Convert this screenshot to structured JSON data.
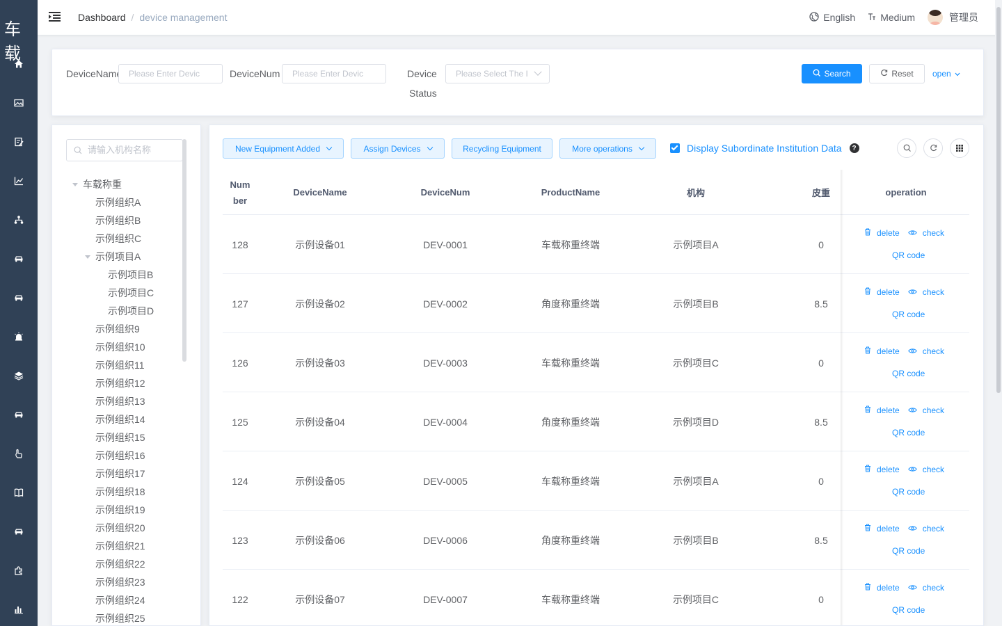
{
  "sidebar": {
    "logo": "车载",
    "icons": [
      "home-icon",
      "image-icon",
      "edit-icon",
      "chart-icon",
      "tree-icon",
      "car-icon",
      "car-icon",
      "alarm-icon",
      "layers-icon",
      "car-icon",
      "hand-icon",
      "book-icon",
      "car-icon",
      "plugin-icon",
      "bar-chart-icon"
    ]
  },
  "header": {
    "breadcrumb_home": "Dashboard",
    "breadcrumb_sep": "/",
    "breadcrumb_current": "device management",
    "language": "English",
    "size": "Medium",
    "user": "管理员"
  },
  "search": {
    "device_name_label": "DeviceName",
    "device_name_placeholder": "Please Enter Devic",
    "device_num_label": "DeviceNum",
    "device_num_placeholder": "Please Enter Devic",
    "status_label_1": "Device",
    "status_label_2": "Status",
    "status_placeholder": "Please Select The I",
    "search_btn": "Search",
    "reset_btn": "Reset",
    "toggle": "open"
  },
  "tree": {
    "search_placeholder": "请输入机构名称",
    "nodes": [
      {
        "label": "车载称重",
        "caret": true
      },
      {
        "label": "示例组织A"
      },
      {
        "label": "示例组织B"
      },
      {
        "label": "示例组织C"
      },
      {
        "label": "示例项目A",
        "caret": true
      },
      {
        "label": "示例项目B"
      },
      {
        "label": "示例项目C"
      },
      {
        "label": "示例项目D"
      },
      {
        "label": "示例组织9"
      },
      {
        "label": "示例组织10"
      },
      {
        "label": "示例组织11"
      },
      {
        "label": "示例组织12"
      },
      {
        "label": "示例组织13"
      },
      {
        "label": "示例组织14"
      },
      {
        "label": "示例组织15"
      },
      {
        "label": "示例组织16"
      },
      {
        "label": "示例组织17"
      },
      {
        "label": "示例组织18"
      },
      {
        "label": "示例组织19"
      },
      {
        "label": "示例组织20"
      },
      {
        "label": "示例组织21"
      },
      {
        "label": "示例组织22"
      },
      {
        "label": "示例组织23"
      },
      {
        "label": "示例组织24"
      },
      {
        "label": "示例组织25"
      }
    ]
  },
  "toolbar": {
    "new_equipment": "New Equipment Added",
    "assign_devices": "Assign Devices",
    "recycling": "Recycling Equipment",
    "more_ops": "More operations",
    "subordinate_label": "Display Subordinate Institution Data",
    "help": "?"
  },
  "table": {
    "headers": {
      "number_1": "Num",
      "number_2": "ber",
      "device_name": "DeviceName",
      "device_num": "DeviceNum",
      "product_name": "ProductName",
      "org": "机构",
      "tare": "皮重",
      "operation": "operation"
    },
    "actions": {
      "delete": "delete",
      "check": "check",
      "qr": "QR code"
    },
    "rows": [
      {
        "number": "128",
        "device_name": "示例设备01",
        "device_num": "DEV-0001",
        "product_name": "车载称重终端",
        "org": "示例项目A",
        "tare": "0"
      },
      {
        "number": "127",
        "device_name": "示例设备02",
        "device_num": "DEV-0002",
        "product_name": "角度称重终端",
        "org": "示例项目B",
        "tare": "8.5"
      },
      {
        "number": "126",
        "device_name": "示例设备03",
        "device_num": "DEV-0003",
        "product_name": "车载称重终端",
        "org": "示例项目C",
        "tare": "0"
      },
      {
        "number": "125",
        "device_name": "示例设备04",
        "device_num": "DEV-0004",
        "product_name": "角度称重终端",
        "org": "示例项目D",
        "tare": "8.5"
      },
      {
        "number": "124",
        "device_name": "示例设备05",
        "device_num": "DEV-0005",
        "product_name": "车载称重终端",
        "org": "示例项目A",
        "tare": "0"
      },
      {
        "number": "123",
        "device_name": "示例设备06",
        "device_num": "DEV-0006",
        "product_name": "角度称重终端",
        "org": "示例项目B",
        "tare": "8.5"
      },
      {
        "number": "122",
        "device_name": "示例设备07",
        "device_num": "DEV-0007",
        "product_name": "车载称重终端",
        "org": "示例项目C",
        "tare": "0"
      }
    ]
  },
  "colors": {
    "sidebar_bg": "#304156",
    "primary": "#1890ff",
    "tool_bg": "#e8f4ff"
  }
}
